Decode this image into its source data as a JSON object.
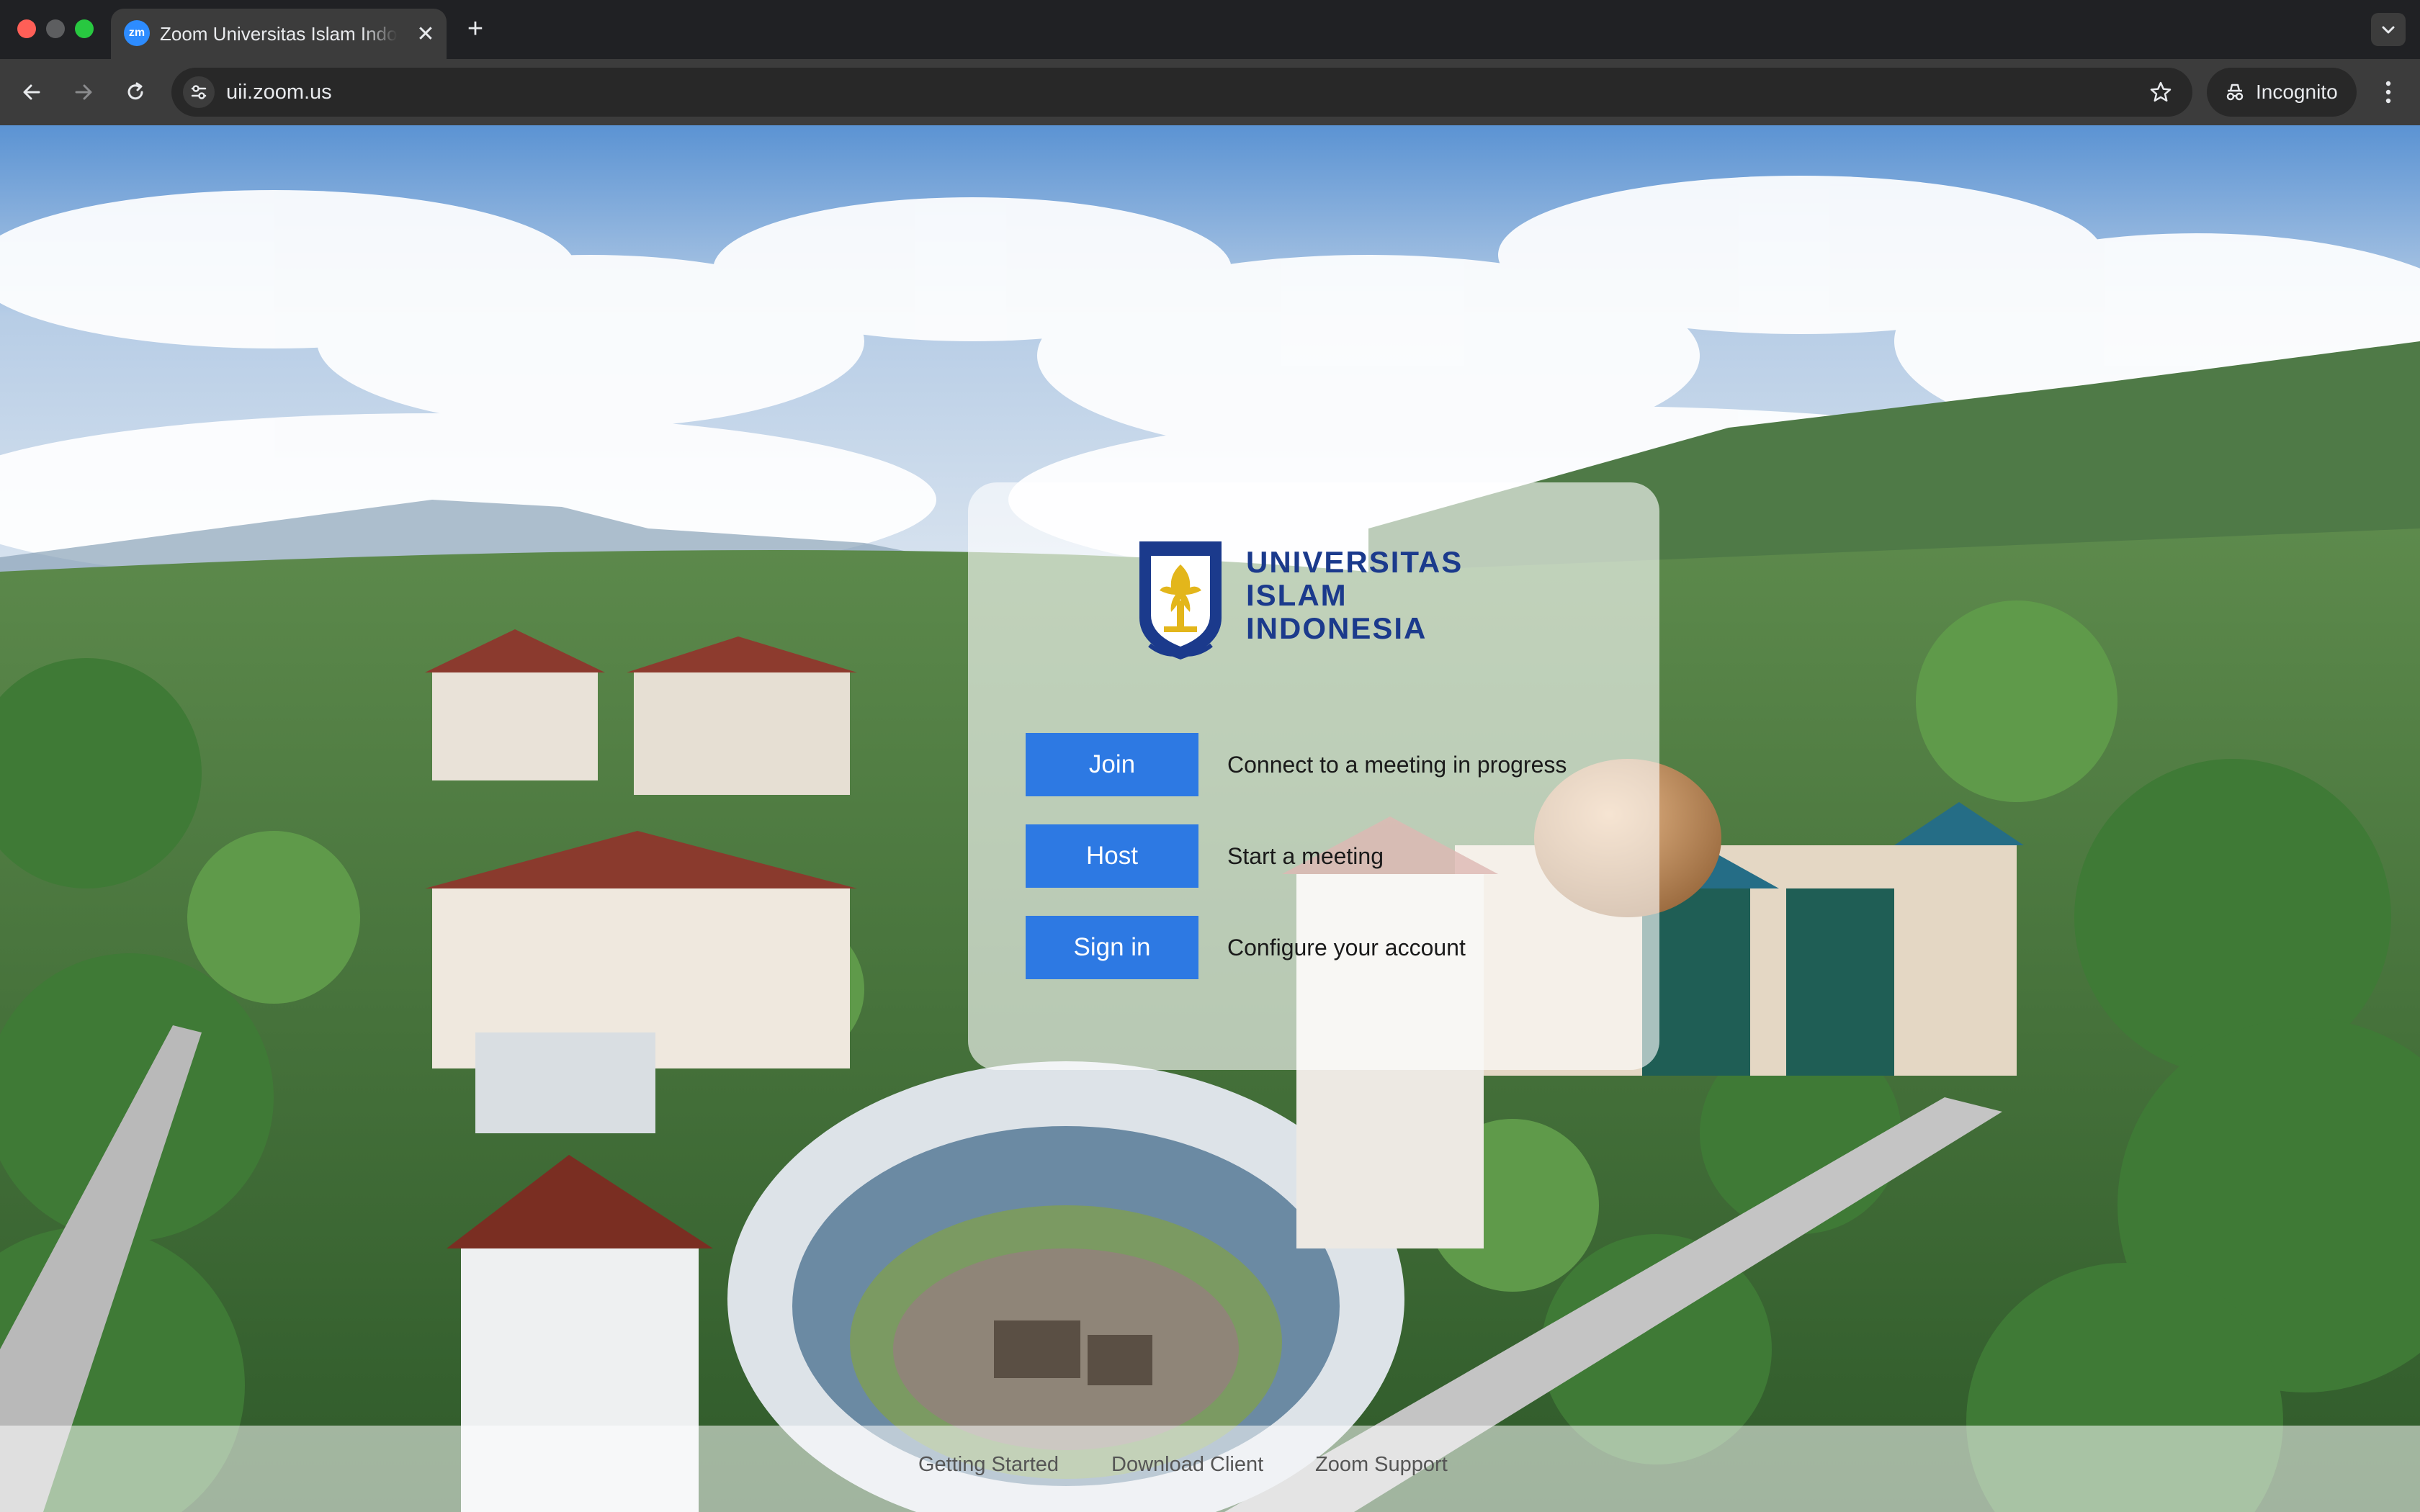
{
  "browser": {
    "tab_title": "Zoom Universitas Islam Indonesia",
    "tab_favicon_text": "zm",
    "url": "uii.zoom.us",
    "incognito_label": "Incognito"
  },
  "logo": {
    "line1": "UNIVERSITAS",
    "line2": "ISLAM",
    "line3": "INDONESIA"
  },
  "actions": [
    {
      "label": "Join",
      "description": "Connect to a meeting in progress"
    },
    {
      "label": "Host",
      "description": "Start a meeting"
    },
    {
      "label": "Sign in",
      "description": "Configure your account"
    }
  ],
  "footer": {
    "links": [
      "Getting Started",
      "Download Client",
      "Zoom Support"
    ]
  },
  "colors": {
    "button_blue": "#2d79e3",
    "logo_blue": "#1b3a8c",
    "emblem_gold": "#e3b61b"
  }
}
